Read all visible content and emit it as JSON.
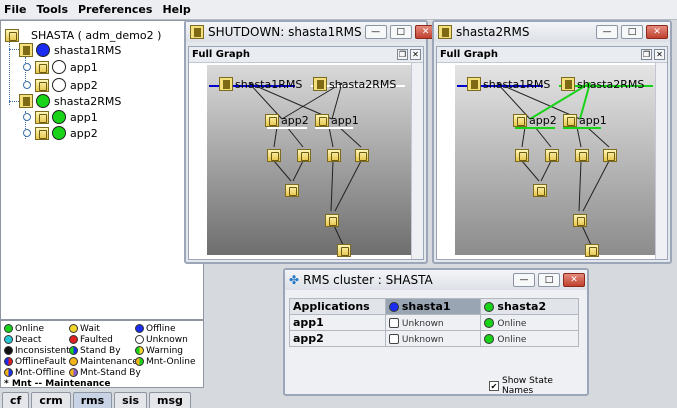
{
  "menu": [
    "File",
    "Tools",
    "Preferences",
    "Help"
  ],
  "tree": {
    "cluster": "SHASTA ( adm_demo2 )",
    "nodes": [
      {
        "label": "shasta1RMS",
        "apps": [
          "app1",
          "app2"
        ]
      },
      {
        "label": "shasta2RMS",
        "apps": [
          "app1",
          "app2"
        ]
      }
    ]
  },
  "legend": [
    [
      "Online",
      "Wait",
      "Offline"
    ],
    [
      "Deact",
      "Faulted",
      "Unknown"
    ],
    [
      "Inconsistent",
      "Stand By",
      "Warning"
    ],
    [
      "OfflineFault",
      "Maintenance",
      "Mnt-Online"
    ],
    [
      "Mnt-Offline",
      "Mnt-Stand By"
    ]
  ],
  "legend_note": "* Mnt -- Maintenance",
  "tabs": [
    "cf",
    "crm",
    "rms",
    "sis",
    "msg"
  ],
  "win1": {
    "title": "SHUTDOWN: shasta1RMS",
    "sub": "Full Graph",
    "nodes": [
      "shasta1RMS",
      "shasta2RMS"
    ],
    "apps": [
      "app2",
      "app1"
    ]
  },
  "win2": {
    "title": "shasta2RMS",
    "sub": "Full Graph",
    "nodes": [
      "shasta1RMS",
      "shasta2RMS"
    ],
    "apps": [
      "app2",
      "app1"
    ]
  },
  "win3": {
    "title": "RMS cluster : SHASTA",
    "headers": [
      "Applications",
      "shasta1",
      "shasta2"
    ],
    "rows": [
      {
        "app": "app1",
        "s1": "Unknown",
        "s2": "Online"
      },
      {
        "app": "app2",
        "s1": "Unknown",
        "s2": "Online"
      }
    ],
    "checkbox": "Show State Names"
  },
  "graph_star": "*",
  "colors": {
    "online": "#18d318",
    "offline": "#1a2cf0",
    "accent": "#0000cc"
  }
}
